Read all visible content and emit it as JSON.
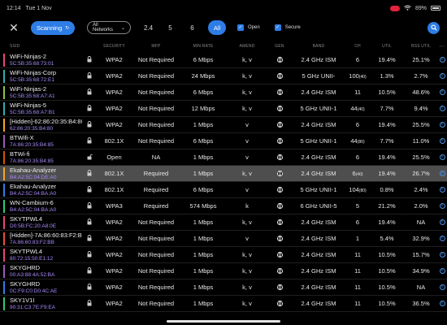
{
  "status": {
    "time": "12:14",
    "date": "Tue 1 Nov",
    "battery": "89%"
  },
  "toolbar": {
    "scan_label": "Scanning",
    "networks_label": "All Networks",
    "bands": [
      "2.4",
      "5",
      "6"
    ],
    "all_label": "All",
    "open_label": "Open",
    "secure_label": "Secure"
  },
  "columns": {
    "ssid": "SSID",
    "security": "SECURITY",
    "mfp": "MFP",
    "rate": "MIN RATE",
    "amend": "AMEND",
    "gen": "GEN",
    "band": "BAND",
    "ch": "CH",
    "util": "UTIL",
    "bss": "BSS UTIL"
  },
  "rows": [
    {
      "name": "WiFi-Ninjas-2",
      "mac": "5C:5B:35:68:73:01",
      "lock": true,
      "sec": "WPA2",
      "mfp": "Not Required",
      "rate": "6 Mbps",
      "amend": "k, v",
      "band": "2.4 GHz ISM",
      "ch": "6",
      "chsup": "",
      "util": "19.4%",
      "bss": "25.1%",
      "color": "#e8457a"
    },
    {
      "name": "WiFi-Ninjas-Corp",
      "mac": "5C:5B:35:68:72:E1",
      "lock": true,
      "sec": "WPA2",
      "mfp": "Not Required",
      "rate": "24 Mbps",
      "amend": "k, v",
      "band": "5 GHz UNII-",
      "ch": "100",
      "chsup": "(40)",
      "util": "1.3%",
      "bss": "2.7%",
      "color": "#2fb0a8"
    },
    {
      "name": "WiFi-Ninjas-2",
      "mac": "5C:5B:35:68:A7:A1",
      "lock": true,
      "sec": "WPA2",
      "mfp": "Not Required",
      "rate": "6 Mbps",
      "amend": "k, v",
      "band": "2.4 GHz ISM",
      "ch": "11",
      "chsup": "",
      "util": "10.5%",
      "bss": "48.6%",
      "color": "#8bc34a"
    },
    {
      "name": "WiFi-Ninjas-5",
      "mac": "5C:5B:35:68:A7:B1",
      "lock": true,
      "sec": "WPA2",
      "mfp": "Not Required",
      "rate": "12 Mbps",
      "amend": "k, v",
      "band": "5 GHz UNII-1",
      "ch": "44",
      "chsup": "(40)",
      "util": "7.7%",
      "bss": "9.4%",
      "color": "#2fb0a8"
    },
    {
      "name": "[Hidden]-62:86:20:35:B4:80",
      "mac": "62:86:20:35:B4:80",
      "lock": true,
      "sec": "WPA2",
      "mfp": "Not Required",
      "rate": "1 Mbps",
      "amend": "v",
      "band": "2.4 GHz ISM",
      "ch": "6",
      "chsup": "",
      "util": "19.4%",
      "bss": "25.5%",
      "color": "#f5a623"
    },
    {
      "name": "BTWifi-X",
      "mac": "7A:86:20:35:B4:85",
      "lock": true,
      "sec": "802.1X",
      "mfp": "Not Required",
      "rate": "6 Mbps",
      "amend": "v",
      "band": "5 GHz UNII-1",
      "ch": "44",
      "chsup": "(80)",
      "util": "7.7%",
      "bss": "11.0%",
      "color": "#9b59b6"
    },
    {
      "name": "BTWi-fi",
      "mac": "7A:86:20:35:B4:85",
      "lock": false,
      "sec": "Open",
      "mfp": "NA",
      "rate": "1 Mbps",
      "amend": "v",
      "band": "2.4 GHz ISM",
      "ch": "6",
      "chsup": "",
      "util": "19.4%",
      "bss": "25.5%",
      "color": "#d35400"
    },
    {
      "name": "Ekahau-Analyzer",
      "mac": "B4:A2:5C:04:DE:A0",
      "lock": true,
      "sec": "802.1X",
      "mfp": "Required",
      "rate": "1 Mbps",
      "amend": "k, v",
      "band": "2.4 GHz ISM",
      "ch": "6",
      "chsup": "(40)",
      "util": "19.4%",
      "bss": "26.7%",
      "color": "#f5a623",
      "selected": true
    },
    {
      "name": "Ekahau-Analyzer",
      "mac": "B4:A2:5C:04:BA:A0",
      "lock": true,
      "sec": "802.1X",
      "mfp": "Required",
      "rate": "6 Mbps",
      "amend": "v",
      "band": "5 GHz UNII-1",
      "ch": "104",
      "chsup": "(80)",
      "util": "0.8%",
      "bss": "2.4%",
      "color": "#2e7de6"
    },
    {
      "name": "WN-Cambium-6",
      "mac": "B4:A2:5C:04:BA:A0",
      "lock": true,
      "sec": "WPA3",
      "mfp": "Required",
      "rate": "574 Mbps",
      "amend": "k",
      "band": "6 GHz UNII-5",
      "ch": "5",
      "chsup": "",
      "util": "21.2%",
      "bss": "2.0%",
      "color": "#2ecc71"
    },
    {
      "name": "SKYTPWL4",
      "mac": "D0:5B:FC:20:A8:0E",
      "lock": true,
      "sec": "WPA2",
      "mfp": "Not Required",
      "rate": "1 Mbps",
      "amend": "k, v",
      "band": "2.4 GHz ISM",
      "ch": "6",
      "chsup": "",
      "util": "19.4%",
      "bss": "NA",
      "color": "#e8457a"
    },
    {
      "name": "[Hidden]-7A:86:60:83:F2:BB",
      "mac": "7A:86:60:83:F2:BB",
      "lock": true,
      "sec": "WPA2",
      "mfp": "Not Required",
      "rate": "1 Mbps",
      "amend": "v",
      "band": "2.4 GHz ISM",
      "ch": "1",
      "chsup": "",
      "util": "5.4%",
      "bss": "32.9%",
      "color": "#e74c3c"
    },
    {
      "name": "SKYTPWL4",
      "mac": "80:72:15:50:E1:12",
      "lock": true,
      "sec": "WPA2",
      "mfp": "Not Required",
      "rate": "1 Mbps",
      "amend": "k, v",
      "band": "2.4 GHz ISM",
      "ch": "11",
      "chsup": "",
      "util": "10.5%",
      "bss": "15.7%",
      "color": "#e8457a"
    },
    {
      "name": "SKYGHRD",
      "mac": "00:A3:88:4A:52:BA",
      "lock": true,
      "sec": "WPA2",
      "mfp": "Not Required",
      "rate": "1 Mbps",
      "amend": "k, v",
      "band": "2.4 GHz ISM",
      "ch": "11",
      "chsup": "",
      "util": "10.5%",
      "bss": "34.9%",
      "color": "#9b59b6"
    },
    {
      "name": "SKYGHRD",
      "mac": "0C:F9:C0:D0:4C:AE",
      "lock": true,
      "sec": "WPA2",
      "mfp": "Not Required",
      "rate": "1 Mbps",
      "amend": "k, v",
      "band": "2.4 GHz ISM",
      "ch": "11",
      "chsup": "",
      "util": "10.5%",
      "bss": "NA",
      "color": "#2e7de6"
    },
    {
      "name": "SKY1V1I",
      "mac": "90:31:C3:7E:F9:EA",
      "lock": true,
      "sec": "WPA2",
      "mfp": "Not Required",
      "rate": "1 Mbps",
      "amend": "k, v",
      "band": "2.4 GHz ISM",
      "ch": "11",
      "chsup": "",
      "util": "10.5%",
      "bss": "36.5%",
      "color": "#2ecc71"
    }
  ]
}
